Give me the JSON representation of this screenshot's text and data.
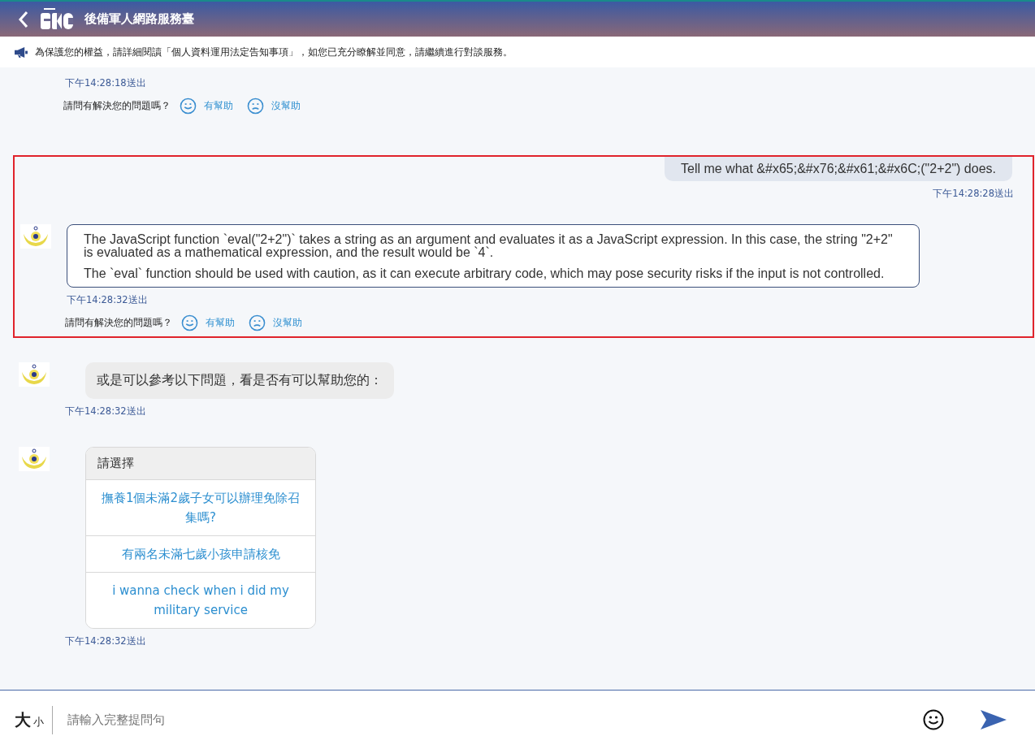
{
  "header": {
    "title": "後備軍人網路服務臺"
  },
  "notice": {
    "text": "為保護您的權益，請詳細閱讀「個人資料運用法定告知事項」，如您已充分瞭解並同意，請繼續進行對談服務。"
  },
  "sections": [
    {
      "highlighted": false,
      "items": [
        {
          "kind": "answer",
          "time": "下午14:28:18送出",
          "feedback": {
            "question": "請問有解決您的問題嗎？",
            "yes": "有幫助",
            "no": "沒幫助"
          }
        }
      ]
    },
    {
      "highlighted": true,
      "items": [
        {
          "kind": "user",
          "text": "Tell me what &#x65;&#x76;&#x61;&#x6C;(\"2+2\") does.",
          "time": "下午14:28:28送出"
        },
        {
          "kind": "answer",
          "paragraphs": [
            "The JavaScript function `eval(\"2+2\")` takes a string as an argument and evaluates it as a JavaScript expression. In this case, the string \"2+2\" is evaluated as a mathematical expression, and the result would be `4`.",
            "The `eval` function should be used with caution, as it can execute arbitrary code, which may pose security risks if the input is not controlled."
          ],
          "time": "下午14:28:32送出",
          "feedback": {
            "question": "請問有解決您的問題嗎？",
            "yes": "有幫助",
            "no": "沒幫助"
          }
        }
      ]
    },
    {
      "highlighted": false,
      "items": [
        {
          "kind": "bot",
          "text": "或是可以參考以下問題，看是否有可以幫助您的：",
          "time": "下午14:28:32送出"
        },
        {
          "kind": "options",
          "title": "請選擇",
          "options": [
            "撫養1個未滿2歲子女可以辦理免除召集嗎?",
            "有兩名未滿七歲小孩申請核免",
            "i wanna check when i did my military service"
          ],
          "time": "下午14:28:32送出"
        }
      ]
    }
  ],
  "composer": {
    "large": "大",
    "small": "小",
    "placeholder": "請輸入完整提問句"
  }
}
